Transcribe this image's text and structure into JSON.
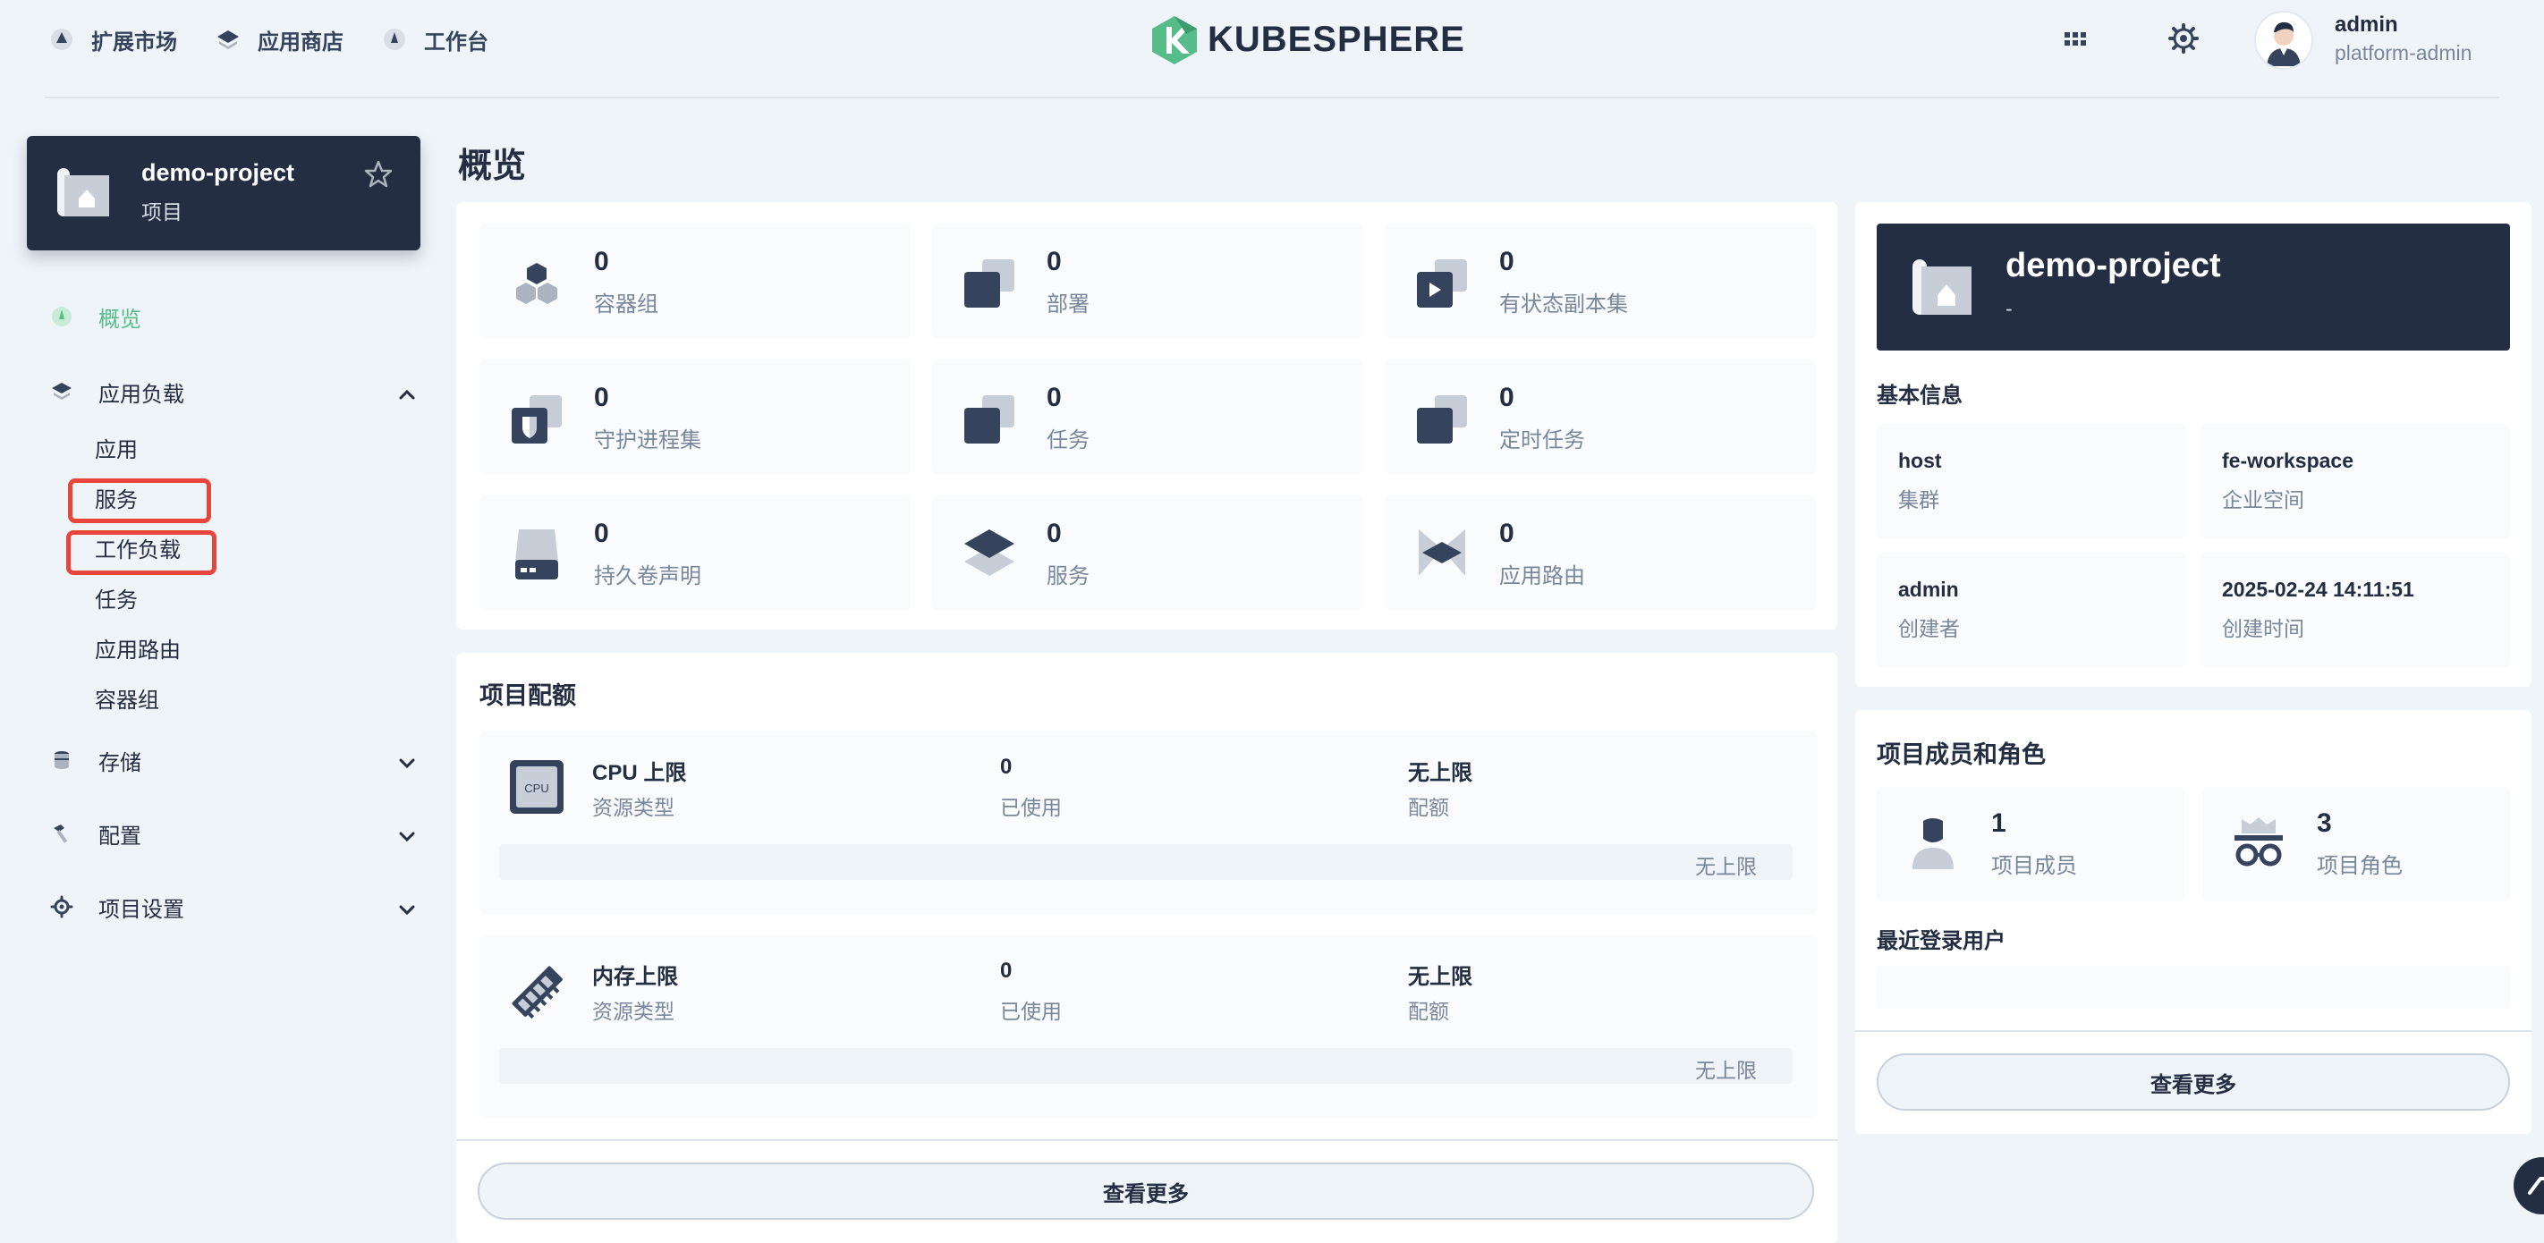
{
  "topnav": {
    "items": [
      {
        "label": "扩展市场",
        "icon": "extensions-icon"
      },
      {
        "label": "应用商店",
        "icon": "app-store-icon"
      },
      {
        "label": "工作台",
        "icon": "workbench-icon"
      }
    ],
    "logo_text": "KUBESPHERE",
    "user": {
      "name": "admin",
      "role": "platform-admin"
    }
  },
  "sidebar": {
    "project": {
      "name": "demo-project",
      "type": "项目"
    },
    "overview": "概览",
    "groups": [
      {
        "label": "应用负载",
        "expanded": true,
        "items": [
          "应用",
          "服务",
          "工作负载",
          "任务",
          "应用路由",
          "容器组"
        ]
      },
      {
        "label": "存储",
        "expanded": false
      },
      {
        "label": "配置",
        "expanded": false
      },
      {
        "label": "项目设置",
        "expanded": false
      }
    ],
    "highlighted": [
      "服务",
      "工作负载"
    ]
  },
  "main": {
    "title": "概览",
    "resources": [
      {
        "count": "0",
        "label": "容器组",
        "icon": "pods-icon"
      },
      {
        "count": "0",
        "label": "部署",
        "icon": "deployment-icon"
      },
      {
        "count": "0",
        "label": "有状态副本集",
        "icon": "statefulset-icon"
      },
      {
        "count": "0",
        "label": "守护进程集",
        "icon": "daemonset-icon"
      },
      {
        "count": "0",
        "label": "任务",
        "icon": "job-icon"
      },
      {
        "count": "0",
        "label": "定时任务",
        "icon": "cronjob-icon"
      },
      {
        "count": "0",
        "label": "持久卷声明",
        "icon": "pvc-icon"
      },
      {
        "count": "0",
        "label": "服务",
        "icon": "service-icon"
      },
      {
        "count": "0",
        "label": "应用路由",
        "icon": "ingress-icon"
      }
    ],
    "quota": {
      "title": "项目配额",
      "items": [
        {
          "name": "CPU 上限",
          "name_sub": "资源类型",
          "used": "0",
          "used_label": "已使用",
          "limit": "无上限",
          "limit_label": "配额",
          "bar_text": "无上限",
          "icon_text": "CPU",
          "icon": "cpu-icon"
        },
        {
          "name": "内存上限",
          "name_sub": "资源类型",
          "used": "0",
          "used_label": "已使用",
          "limit": "无上限",
          "limit_label": "配额",
          "bar_text": "无上限",
          "icon": "memory-icon"
        }
      ],
      "more_label": "查看更多"
    }
  },
  "right": {
    "project": {
      "name": "demo-project",
      "desc": "-"
    },
    "basic_info_title": "基本信息",
    "basic_info": [
      {
        "value": "host",
        "key": "集群"
      },
      {
        "value": "fe-workspace",
        "key": "企业空间"
      },
      {
        "value": "admin",
        "key": "创建者"
      },
      {
        "value": "2025-02-24 14:11:51",
        "key": "创建时间"
      }
    ],
    "members_title": "项目成员和角色",
    "members": [
      {
        "count": "1",
        "label": "项目成员",
        "icon": "member-icon"
      },
      {
        "count": "3",
        "label": "项目角色",
        "icon": "role-icon"
      }
    ],
    "recent_title": "最近登录用户",
    "more_label": "查看更多"
  },
  "colors": {
    "dark": "#242e42",
    "accent": "#55bc8a",
    "muted": "#79879c",
    "highlight_box": "#e8453c"
  }
}
